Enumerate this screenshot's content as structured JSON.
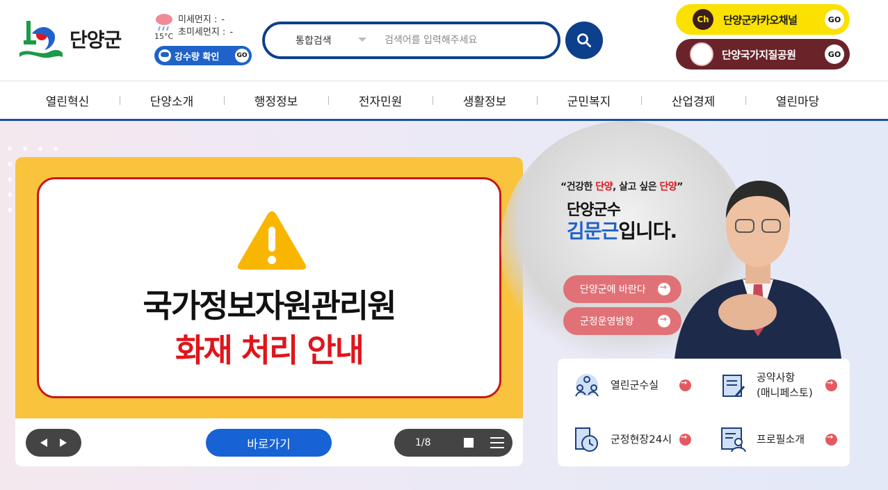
{
  "header": {
    "logo_text": "단양군",
    "weather": {
      "temperature": "15°C",
      "fine_dust_label": "미세먼지 :",
      "fine_dust_value": "-",
      "ultrafine_dust_label": "초미세먼지 :",
      "ultrafine_dust_value": "-",
      "rain_button_label": "강수량 확인",
      "go_label": "GO"
    },
    "search": {
      "type_selected": "통합검색",
      "placeholder": "검색어를 입력해주세요"
    },
    "kakao": {
      "icon_text": "Ch",
      "label": "단양군카카오채널",
      "go_label": "GO"
    },
    "geopark": {
      "label": "단양국가지질공원",
      "go_label": "GO"
    }
  },
  "nav": {
    "items": [
      "열린혁신",
      "단양소개",
      "행정정보",
      "전자민원",
      "생활정보",
      "군민복지",
      "산업경제",
      "열린마당"
    ]
  },
  "slide": {
    "title": "국가정보자원관리원",
    "subtitle": "화재 처리 안내",
    "goto_label": "바로가기",
    "pager": "1/8"
  },
  "mayor": {
    "quote_open": "“건강한 ",
    "quote_r1": "단양",
    "quote_mid": ", 살고 싶은 ",
    "quote_r2": "단양",
    "quote_close": "”",
    "title": "단양군수",
    "name": "김문근",
    "name_suffix": "입니다.",
    "button1": "단양군에 바란다",
    "button2": "군정운영방향"
  },
  "quick_links": {
    "q1": "열린군수실",
    "q2_line1": "공약사항",
    "q2_line2": "(매니페스토)",
    "q3": "군정현장24시",
    "q4": "프로필소개"
  },
  "colors": {
    "brand_navy": "#0c3f8c",
    "kakao_yellow": "#fae100",
    "geopark_maroon": "#6a2329",
    "slide_yellow": "#f9c33d",
    "alert_red": "#e0151b",
    "pink_button": "#e07277"
  }
}
